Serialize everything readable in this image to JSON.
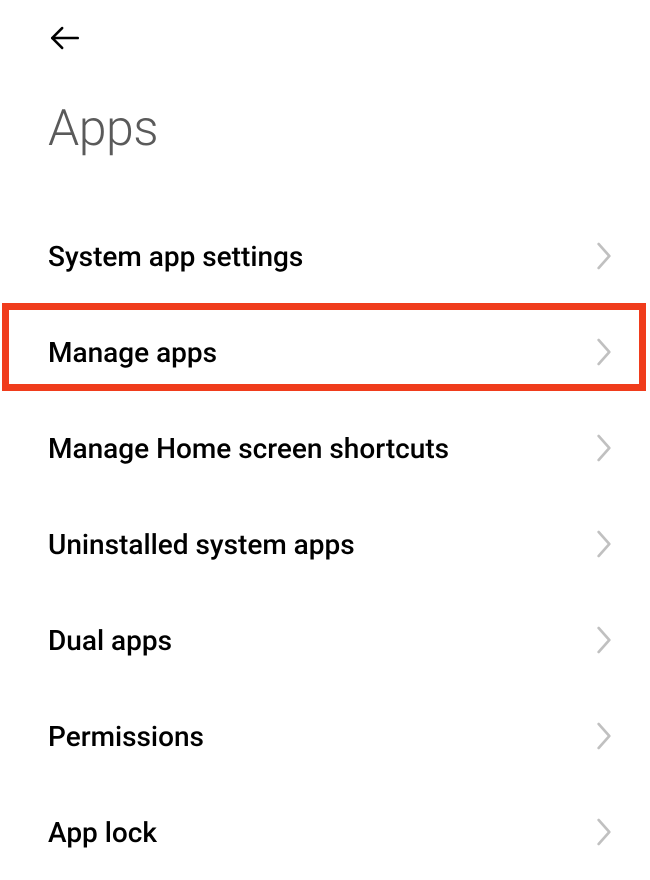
{
  "page_title": "Apps",
  "highlight_color": "#f03c1c",
  "highlighted_index": 1,
  "items": [
    {
      "label": "System app settings"
    },
    {
      "label": "Manage apps"
    },
    {
      "label": "Manage Home screen shortcuts"
    },
    {
      "label": "Uninstalled system apps"
    },
    {
      "label": "Dual apps"
    },
    {
      "label": "Permissions"
    },
    {
      "label": "App lock"
    }
  ]
}
